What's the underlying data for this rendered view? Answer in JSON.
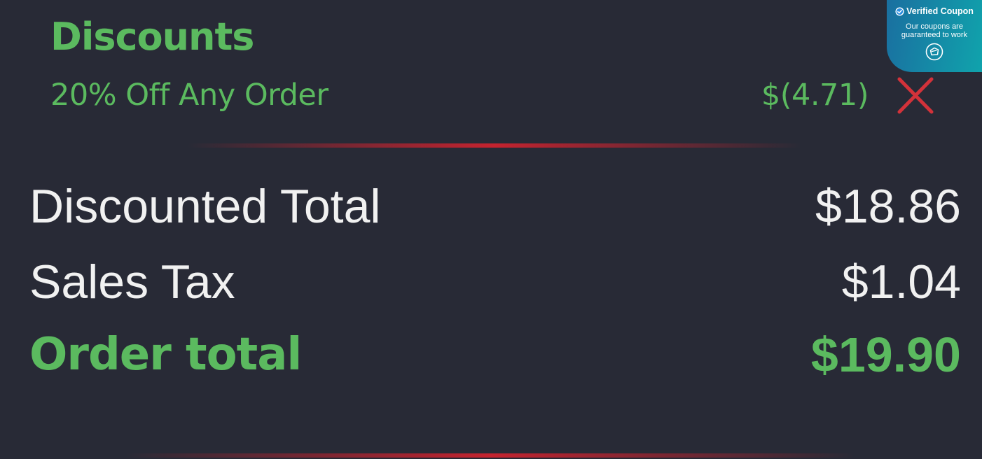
{
  "colors": {
    "background": "#282a36",
    "green": "#5bba5f",
    "white_text": "#f1f1f1",
    "remove_red": "#d3323a",
    "divider_red": "#c4232f",
    "badge_gradient_start": "#1a6fa0",
    "badge_gradient_end": "#10a3ac"
  },
  "discounts": {
    "heading": "Discounts",
    "items": [
      {
        "name": "20% Off Any Order",
        "amount": "$(4.71)",
        "remove_icon": "close-x-icon"
      }
    ]
  },
  "summary": {
    "discounted_total": {
      "label": "Discounted Total",
      "value": "$18.86"
    },
    "sales_tax": {
      "label": "Sales Tax",
      "value": "$1.04"
    },
    "order_total": {
      "label": "Order total",
      "value": "$19.90"
    }
  },
  "verified_badge": {
    "title": "Verified Coupon",
    "subtitle": "Our coupons are guaranteed to work",
    "check_icon": "check-circle-icon",
    "logo_icon": "brand-logo-icon"
  }
}
